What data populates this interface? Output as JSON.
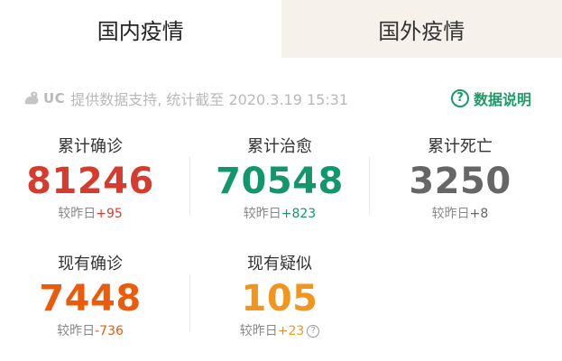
{
  "tabs": [
    {
      "label": "国内疫情",
      "active": true
    },
    {
      "label": "国外疫情",
      "active": false
    }
  ],
  "source": {
    "brand": "UC",
    "text": "提供数据支持, 统计截至 2020.3.19 15:31",
    "help_label": "数据说明"
  },
  "stats": {
    "confirmed_total": {
      "label": "累计确诊",
      "value": "81246",
      "delta_label": "较昨日",
      "delta": "+95"
    },
    "cured_total": {
      "label": "累计治愈",
      "value": "70548",
      "delta_label": "较昨日",
      "delta": "+823"
    },
    "deaths_total": {
      "label": "累计死亡",
      "value": "3250",
      "delta_label": "较昨日",
      "delta": "+8"
    },
    "confirmed_current": {
      "label": "现有确诊",
      "value": "7448",
      "delta_label": "较昨日",
      "delta": "-736"
    },
    "suspected_current": {
      "label": "现有疑似",
      "value": "105",
      "delta_label": "较昨日",
      "delta": "+23"
    }
  },
  "colors": {
    "confirmed": "#d63c2e",
    "cured": "#12976a",
    "deaths": "#666666",
    "current_confirmed": "#ea5b0c",
    "suspected": "#f0951e",
    "help": "#1a9a66",
    "inactive_tab_bg": "#f6f1ea"
  },
  "icons": {
    "brand": "uc-squirrel-icon",
    "help": "question-circle-icon",
    "info": "question-circle-icon"
  }
}
